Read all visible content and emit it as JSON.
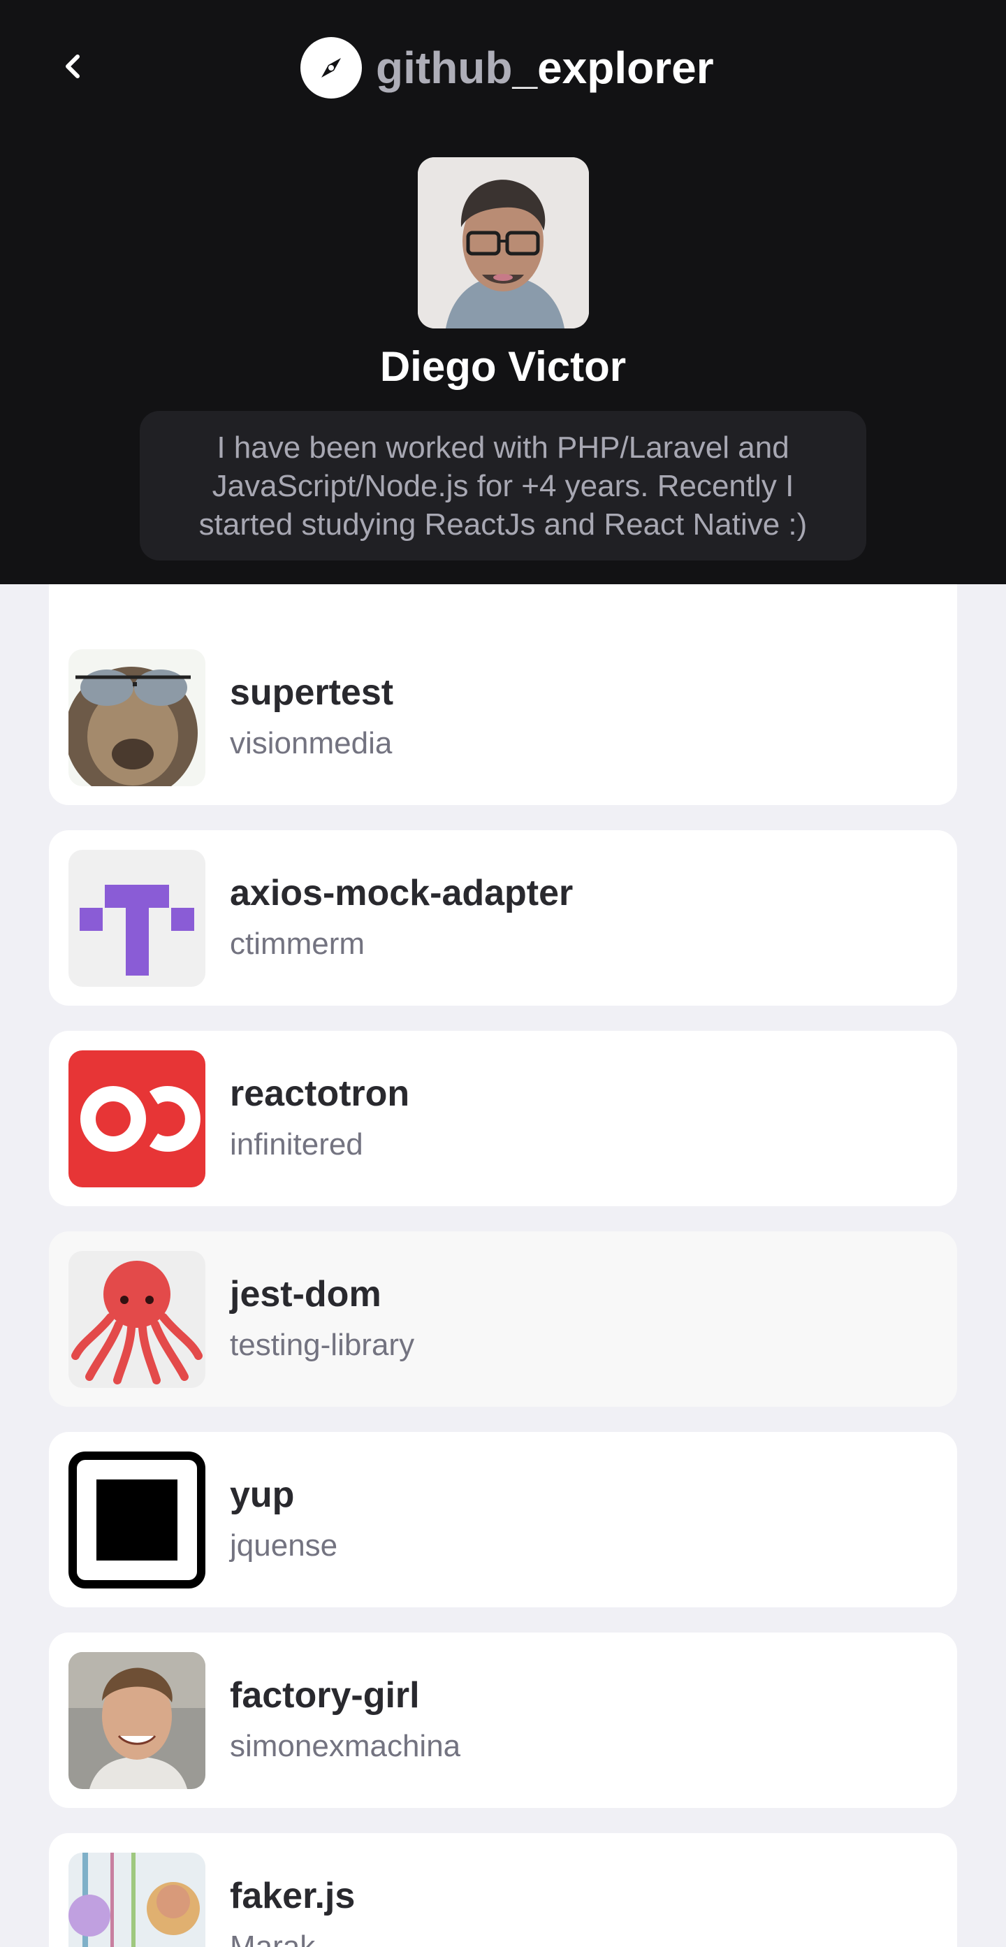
{
  "header": {
    "brand_part1": "github",
    "brand_part2": "_explorer",
    "back_icon": "chevron-left-icon",
    "logo_icon": "compass-icon"
  },
  "profile": {
    "name": "Diego Victor",
    "bio": "I have been worked with PHP/Laravel and JavaScript/Node.js for +4 years. Recently I started studying ReactJs and React Native :)"
  },
  "repos": [
    {
      "title": "supertest",
      "owner": "visionmedia"
    },
    {
      "title": "axios-mock-adapter",
      "owner": "ctimmerm"
    },
    {
      "title": "reactotron",
      "owner": "infinitered"
    },
    {
      "title": "jest-dom",
      "owner": "testing-library"
    },
    {
      "title": "yup",
      "owner": "jquense"
    },
    {
      "title": "factory-girl",
      "owner": "simonexmachina"
    },
    {
      "title": "faker.js",
      "owner": "Marak"
    }
  ],
  "colors": {
    "header_bg": "#121214",
    "bio_bg": "#202024",
    "page_bg": "#f0f0f5",
    "card_bg": "#ffffff",
    "reactotron_red": "#e73536",
    "mock_adapter_purple": "#8a5cd6"
  }
}
